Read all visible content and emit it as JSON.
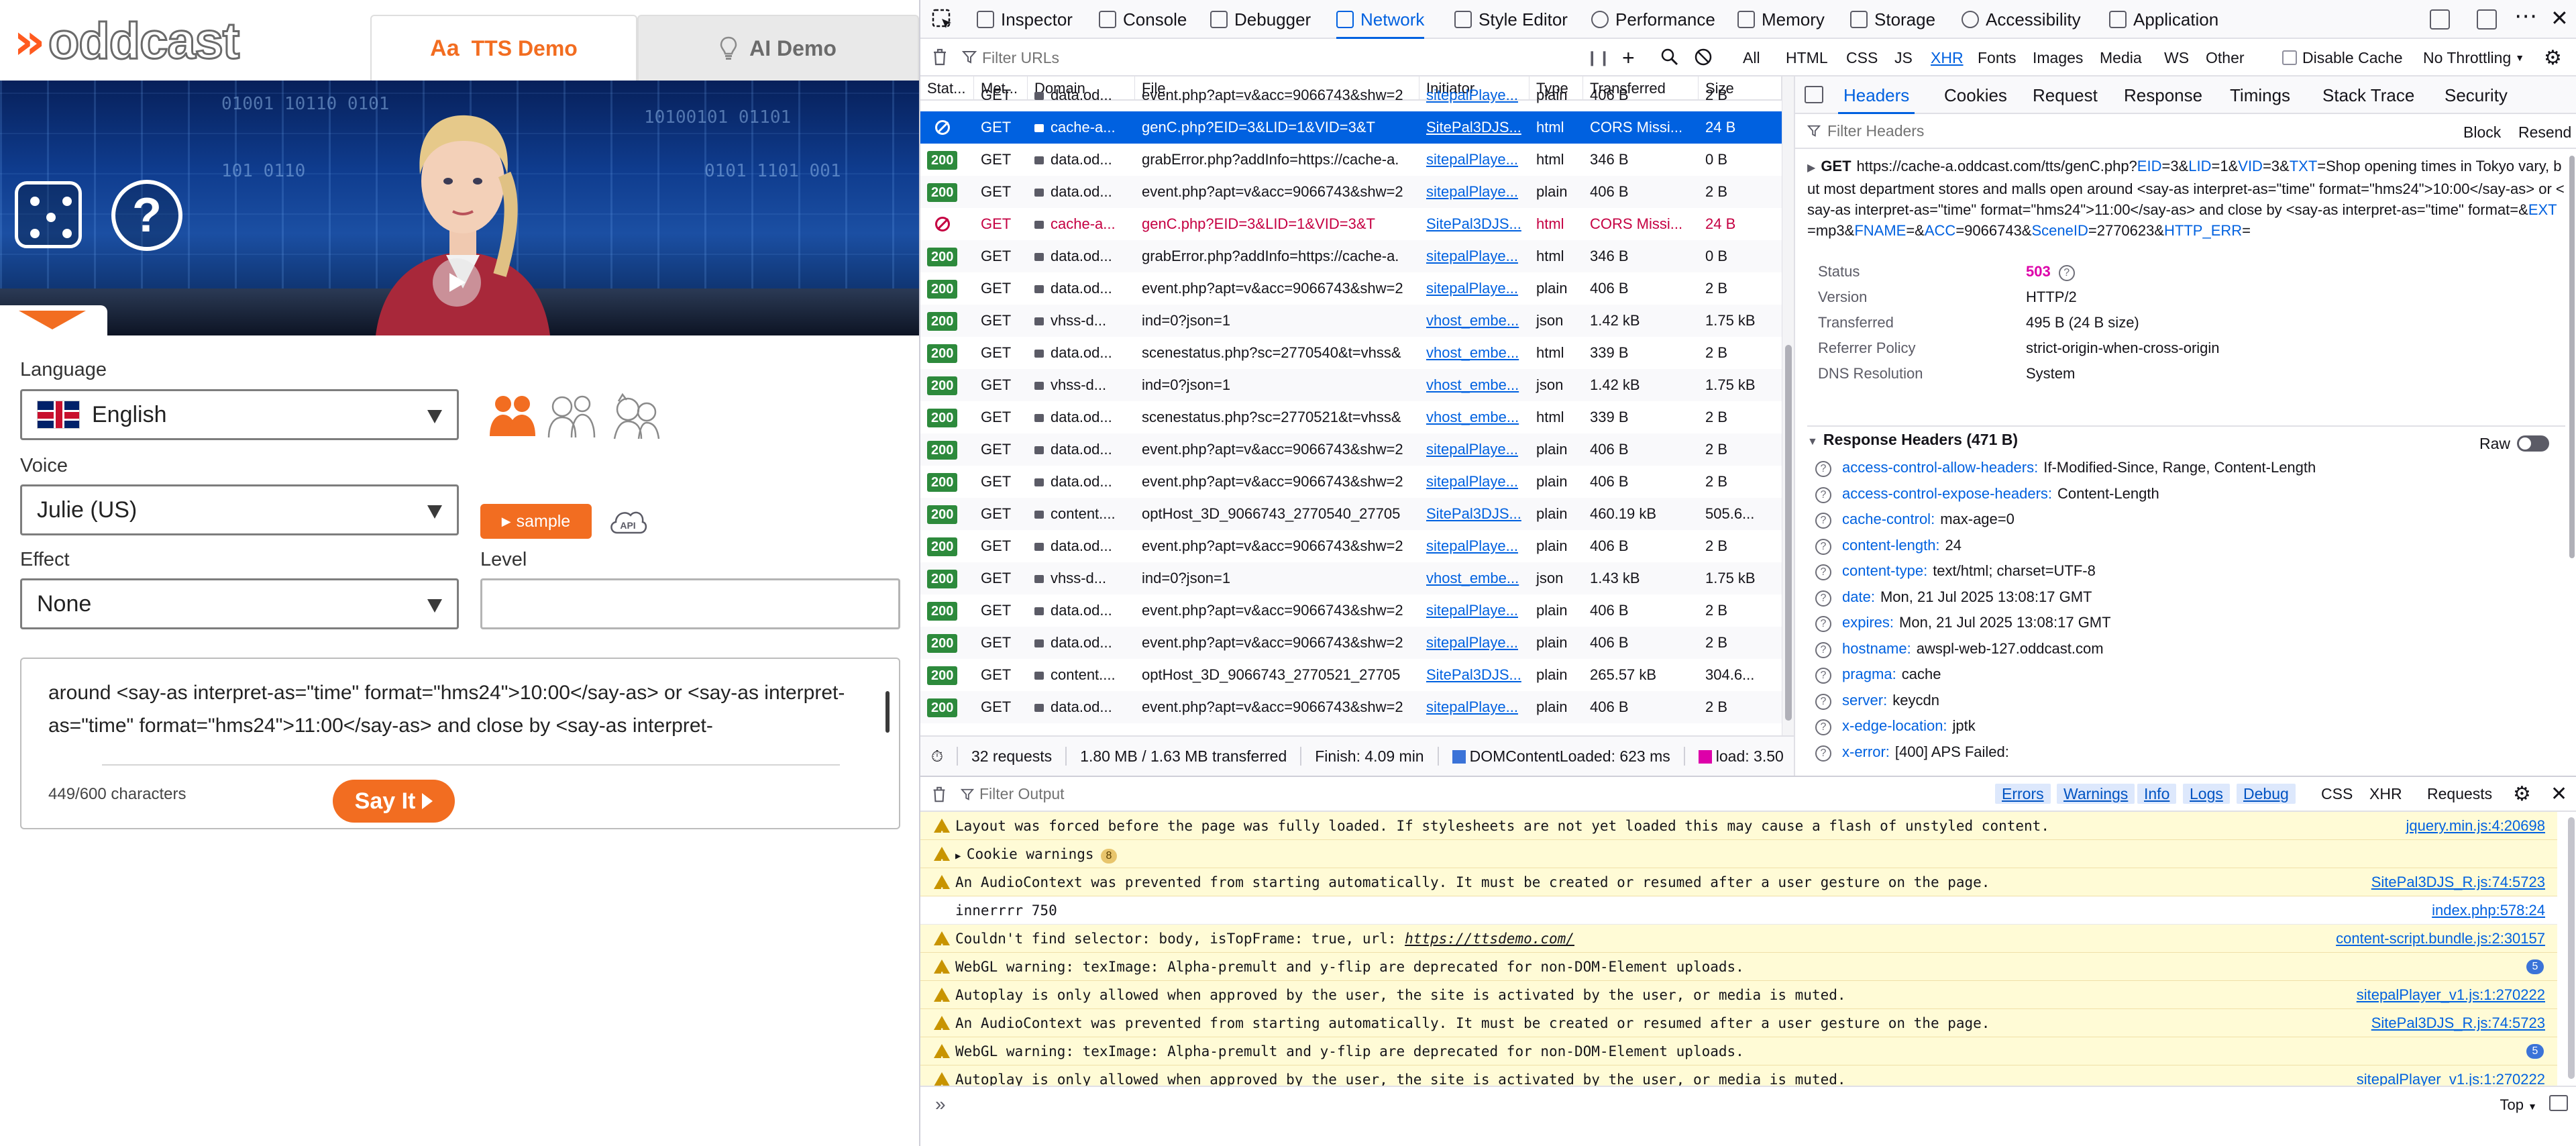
{
  "left": {
    "logo_text": "oddcast",
    "tabs": [
      {
        "label": "TTS Demo",
        "icon": "text-aa-icon"
      },
      {
        "label": "AI Demo",
        "icon": "lightbulb-icon"
      }
    ],
    "language": {
      "label": "Language",
      "value": "English"
    },
    "voice": {
      "label": "Voice",
      "value": "Julie (US)"
    },
    "sample_label": "sample",
    "effect": {
      "label": "Effect",
      "value": "None"
    },
    "level": {
      "label": "Level",
      "value": ""
    },
    "text_content": "around <say-as interpret-as=\"time\" format=\"hms24\">10:00</say-as> or <say-as interpret-as=\"time\" format=\"hms24\">11:00</say-as> and close by <say-as interpret-",
    "char_count": "449/600 characters",
    "say_it_label": "Say It",
    "accent_color": "#f26d21"
  },
  "devtools": {
    "tabs": [
      "Inspector",
      "Console",
      "Debugger",
      "Network",
      "Style Editor",
      "Performance",
      "Memory",
      "Storage",
      "Accessibility",
      "Application"
    ],
    "active_tab": "Network",
    "filter_placeholder": "Filter URLs",
    "type_filters": [
      "All",
      "HTML",
      "CSS",
      "JS",
      "XHR",
      "Fonts",
      "Images",
      "Media",
      "WS",
      "Other"
    ],
    "active_type_filter": "XHR",
    "disable_cache_label": "Disable Cache",
    "throttling": "No Throttling",
    "columns": [
      "Stat...",
      "Met...",
      "Domain",
      "File",
      "Initiator",
      "Type",
      "Transferred",
      "Size"
    ],
    "requests": [
      {
        "status": "",
        "method": "GET",
        "domain": "data.od...",
        "file": "event.php?apt=v&acc=9066743&shw=2",
        "initiator": "sitepalPlaye...",
        "type": "plain",
        "transferred": "406 B",
        "size": "2 B",
        "state": "partial"
      },
      {
        "status": "blocked",
        "method": "GET",
        "domain": "cache-a...",
        "file": "genC.php?EID=3&LID=1&VID=3&T",
        "initiator": "SitePal3DJS...",
        "type": "html",
        "transferred": "CORS Missi...",
        "size": "24 B",
        "state": "selected"
      },
      {
        "status": "200",
        "method": "GET",
        "domain": "data.od...",
        "file": "grabError.php?addInfo=https://cache-a.",
        "initiator": "sitepalPlaye...",
        "type": "html",
        "transferred": "346 B",
        "size": "0 B",
        "state": ""
      },
      {
        "status": "200",
        "method": "GET",
        "domain": "data.od...",
        "file": "event.php?apt=v&acc=9066743&shw=2",
        "initiator": "sitepalPlaye...",
        "type": "plain",
        "transferred": "406 B",
        "size": "2 B",
        "state": ""
      },
      {
        "status": "blocked",
        "method": "GET",
        "domain": "cache-a...",
        "file": "genC.php?EID=3&LID=1&VID=3&T",
        "initiator": "SitePal3DJS...",
        "type": "html",
        "transferred": "CORS Missi...",
        "size": "24 B",
        "state": "blocked"
      },
      {
        "status": "200",
        "method": "GET",
        "domain": "data.od...",
        "file": "grabError.php?addInfo=https://cache-a.",
        "initiator": "sitepalPlaye...",
        "type": "html",
        "transferred": "346 B",
        "size": "0 B",
        "state": ""
      },
      {
        "status": "200",
        "method": "GET",
        "domain": "data.od...",
        "file": "event.php?apt=v&acc=9066743&shw=2",
        "initiator": "sitepalPlaye...",
        "type": "plain",
        "transferred": "406 B",
        "size": "2 B",
        "state": ""
      },
      {
        "status": "200",
        "method": "GET",
        "domain": "vhss-d...",
        "file": "ind=0?json=1",
        "initiator": "vhost_embe...",
        "type": "json",
        "transferred": "1.42 kB",
        "size": "1.75 kB",
        "state": ""
      },
      {
        "status": "200",
        "method": "GET",
        "domain": "data.od...",
        "file": "scenestatus.php?sc=2770540&t=vhss&",
        "initiator": "vhost_embe...",
        "type": "html",
        "transferred": "339 B",
        "size": "2 B",
        "state": ""
      },
      {
        "status": "200",
        "method": "GET",
        "domain": "vhss-d...",
        "file": "ind=0?json=1",
        "initiator": "vhost_embe...",
        "type": "json",
        "transferred": "1.42 kB",
        "size": "1.75 kB",
        "state": ""
      },
      {
        "status": "200",
        "method": "GET",
        "domain": "data.od...",
        "file": "scenestatus.php?sc=2770521&t=vhss&",
        "initiator": "vhost_embe...",
        "type": "html",
        "transferred": "339 B",
        "size": "2 B",
        "state": ""
      },
      {
        "status": "200",
        "method": "GET",
        "domain": "data.od...",
        "file": "event.php?apt=v&acc=9066743&shw=2",
        "initiator": "sitepalPlaye...",
        "type": "plain",
        "transferred": "406 B",
        "size": "2 B",
        "state": ""
      },
      {
        "status": "200",
        "method": "GET",
        "domain": "data.od...",
        "file": "event.php?apt=v&acc=9066743&shw=2",
        "initiator": "sitepalPlaye...",
        "type": "plain",
        "transferred": "406 B",
        "size": "2 B",
        "state": ""
      },
      {
        "status": "200",
        "method": "GET",
        "domain": "content....",
        "file": "optHost_3D_9066743_2770540_27705",
        "initiator": "SitePal3DJS...",
        "type": "plain",
        "transferred": "460.19 kB",
        "size": "505.6...",
        "state": ""
      },
      {
        "status": "200",
        "method": "GET",
        "domain": "data.od...",
        "file": "event.php?apt=v&acc=9066743&shw=2",
        "initiator": "sitepalPlaye...",
        "type": "plain",
        "transferred": "406 B",
        "size": "2 B",
        "state": ""
      },
      {
        "status": "200",
        "method": "GET",
        "domain": "vhss-d...",
        "file": "ind=0?json=1",
        "initiator": "vhost_embe...",
        "type": "json",
        "transferred": "1.43 kB",
        "size": "1.75 kB",
        "state": ""
      },
      {
        "status": "200",
        "method": "GET",
        "domain": "data.od...",
        "file": "event.php?apt=v&acc=9066743&shw=2",
        "initiator": "sitepalPlaye...",
        "type": "plain",
        "transferred": "406 B",
        "size": "2 B",
        "state": ""
      },
      {
        "status": "200",
        "method": "GET",
        "domain": "data.od...",
        "file": "event.php?apt=v&acc=9066743&shw=2",
        "initiator": "sitepalPlaye...",
        "type": "plain",
        "transferred": "406 B",
        "size": "2 B",
        "state": ""
      },
      {
        "status": "200",
        "method": "GET",
        "domain": "content....",
        "file": "optHost_3D_9066743_2770521_27705",
        "initiator": "SitePal3DJS...",
        "type": "plain",
        "transferred": "265.57 kB",
        "size": "304.6...",
        "state": ""
      },
      {
        "status": "200",
        "method": "GET",
        "domain": "data.od...",
        "file": "event.php?apt=v&acc=9066743&shw=2",
        "initiator": "sitepalPlaye...",
        "type": "plain",
        "transferred": "406 B",
        "size": "2 B",
        "state": ""
      }
    ],
    "status_bar": {
      "requests": "32 requests",
      "transferred": "1.80 MB / 1.63 MB transferred",
      "finish": "Finish: 4.09 min",
      "dcl": "DOMContentLoaded: 623 ms",
      "load": "load: 3.50"
    },
    "side_tabs": [
      "Headers",
      "Cookies",
      "Request",
      "Response",
      "Timings",
      "Stack Trace",
      "Security"
    ],
    "active_side_tab": "Headers",
    "headers_filter_placeholder": "Filter Headers",
    "block_label": "Block",
    "resend_label": "Resend",
    "request_method": "GET",
    "request_url_parts": [
      {
        "t": "https://cache-a.oddcast.com/tts/genC.php?",
        "p": false
      },
      {
        "t": "EID",
        "p": true
      },
      {
        "t": "=3&",
        "p": false
      },
      {
        "t": "LID",
        "p": true
      },
      {
        "t": "=1&",
        "p": false
      },
      {
        "t": "VID",
        "p": true
      },
      {
        "t": "=3&",
        "p": false
      },
      {
        "t": "TXT",
        "p": true
      },
      {
        "t": "=Shop opening times in Tokyo vary, but most department stores and malls open around <say-as interpret-as=\"time\" format=\"hms24\">10:00</say-as> or <say-as interpret-as=\"time\" format=\"hms24\">11:00</say-as> and close by <say-as interpret-as=\"time\" format=&",
        "p": false
      },
      {
        "t": "EXT",
        "p": true
      },
      {
        "t": "=mp3&",
        "p": false
      },
      {
        "t": "FNAME",
        "p": true
      },
      {
        "t": "=&",
        "p": false
      },
      {
        "t": "ACC",
        "p": true
      },
      {
        "t": "=9066743&",
        "p": false
      },
      {
        "t": "SceneID",
        "p": true
      },
      {
        "t": "=2770623&",
        "p": false
      },
      {
        "t": "HTTP_ERR",
        "p": true
      },
      {
        "t": "=",
        "p": false
      }
    ],
    "summary": [
      {
        "k": "Status",
        "v": "503"
      },
      {
        "k": "Version",
        "v": "HTTP/2"
      },
      {
        "k": "Transferred",
        "v": "495 B (24 B size)"
      },
      {
        "k": "Referrer Policy",
        "v": "strict-origin-when-cross-origin"
      },
      {
        "k": "DNS Resolution",
        "v": "System"
      }
    ],
    "response_headers_title": "Response Headers (471 B)",
    "raw_label": "Raw",
    "response_headers": [
      {
        "n": "access-control-allow-headers:",
        "v": "If-Modified-Since, Range, Content-Length"
      },
      {
        "n": "access-control-expose-headers:",
        "v": "Content-Length"
      },
      {
        "n": "cache-control:",
        "v": "max-age=0"
      },
      {
        "n": "content-length:",
        "v": "24"
      },
      {
        "n": "content-type:",
        "v": "text/html; charset=UTF-8"
      },
      {
        "n": "date:",
        "v": "Mon, 21 Jul 2025 13:08:17 GMT"
      },
      {
        "n": "expires:",
        "v": "Mon, 21 Jul 2025 13:08:17 GMT"
      },
      {
        "n": "hostname:",
        "v": "awspl-web-127.oddcast.com"
      },
      {
        "n": "pragma:",
        "v": "cache"
      },
      {
        "n": "server:",
        "v": "keycdn"
      },
      {
        "n": "x-edge-location:",
        "v": "jptk"
      },
      {
        "n": "x-error:",
        "v": "[400] APS Failed:"
      }
    ],
    "console_filter_placeholder": "Filter Output",
    "console_levels": [
      "Errors",
      "Warnings",
      "Info",
      "Logs",
      "Debug"
    ],
    "console_types": [
      "CSS",
      "XHR",
      "Requests"
    ],
    "console_messages": [
      {
        "kind": "warn",
        "text": "Layout was forced before the page was fully loaded. If stylesheets are not yet loaded this may cause a flash of unstyled content.",
        "src": "jquery.min.js:4:20698"
      },
      {
        "kind": "group",
        "text": "Cookie warnings",
        "count": "8"
      },
      {
        "kind": "warn",
        "text": "An AudioContext was prevented from starting automatically. It must be created or resumed after a user gesture on the page.",
        "src": "SitePal3DJS_R.js:74:5723"
      },
      {
        "kind": "log",
        "text": "innerrrr 750",
        "src": "index.php:578:24"
      },
      {
        "kind": "warn",
        "text": "Couldn't find selector: body, isTopFrame: true, url: ",
        "url": "https://ttsdemo.com/",
        "src": "content-script.bundle.js:2:30157"
      },
      {
        "kind": "warn-count",
        "text": "WebGL warning: texImage: Alpha-premult and y-flip are deprecated for non-DOM-Element uploads.",
        "count": "5"
      },
      {
        "kind": "warn",
        "text": "Autoplay is only allowed when approved by the user, the site is activated by the user, or media is muted.",
        "src": "sitepalPlayer_v1.js:1:270222"
      },
      {
        "kind": "warn",
        "text": "An AudioContext was prevented from starting automatically. It must be created or resumed after a user gesture on the page.",
        "src": "SitePal3DJS_R.js:74:5723"
      },
      {
        "kind": "warn-count",
        "text": "WebGL warning: texImage: Alpha-premult and y-flip are deprecated for non-DOM-Element uploads.",
        "count": "5"
      },
      {
        "kind": "warn",
        "text": "Autoplay is only allowed when approved by the user, the site is activated by the user, or media is muted.",
        "src": "sitepalPlayer_v1.js:1:270222"
      }
    ],
    "console_context": "Top"
  }
}
